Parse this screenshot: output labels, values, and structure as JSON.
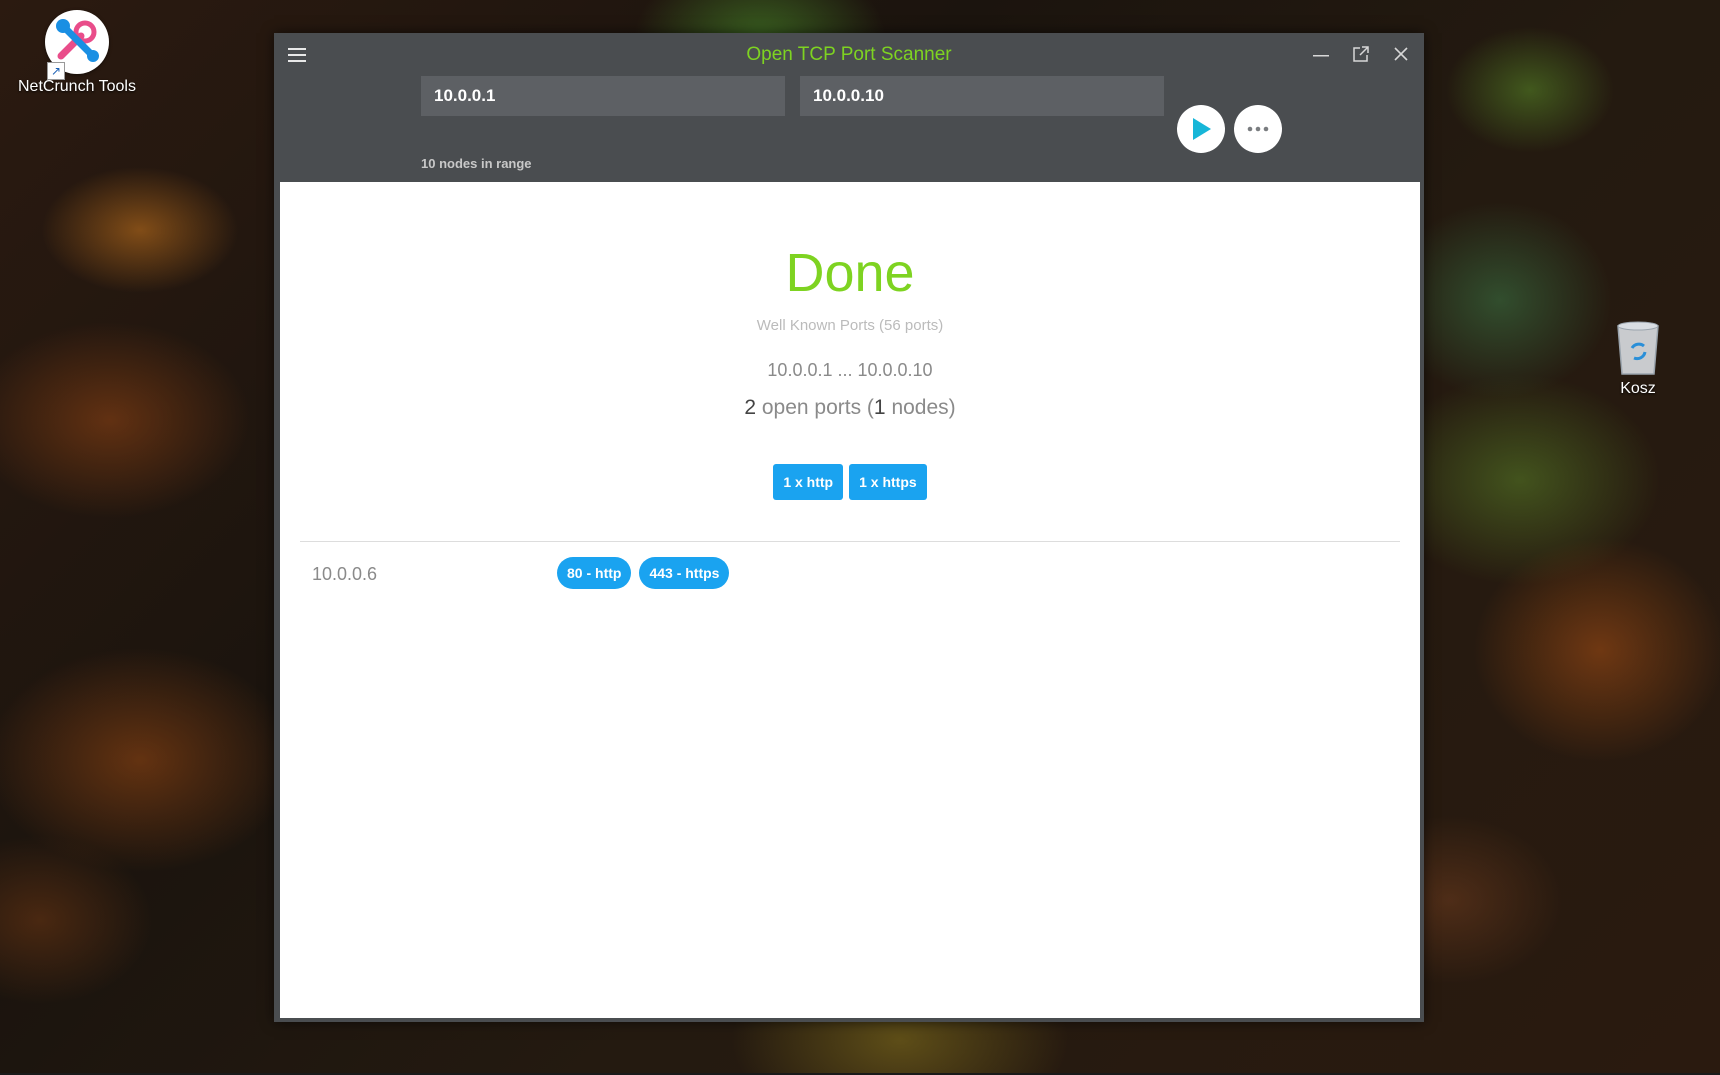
{
  "desktop": {
    "icons": [
      {
        "label": "NetCrunch Tools"
      },
      {
        "label": "Kosz"
      }
    ]
  },
  "window": {
    "title": "Open TCP Port Scanner",
    "accent_color": "#7ed321",
    "tag_color": "#1aa3f0"
  },
  "toolbar": {
    "start_ip": "10.0.0.1",
    "end_ip": "10.0.0.10",
    "nodes_in_range": "10 nodes in range"
  },
  "results": {
    "status": "Done",
    "profile": "Well Known Ports (56 ports)",
    "range": "10.0.0.1 ... 10.0.0.10",
    "open_ports_count": "2",
    "open_ports_label": " open ports (",
    "nodes_count": "1",
    "nodes_label": " nodes)",
    "service_tags": [
      "1 x http",
      "1 x https"
    ],
    "rows": [
      {
        "ip": "10.0.0.6",
        "ports": [
          "80 - http",
          "443 - https"
        ]
      }
    ]
  }
}
